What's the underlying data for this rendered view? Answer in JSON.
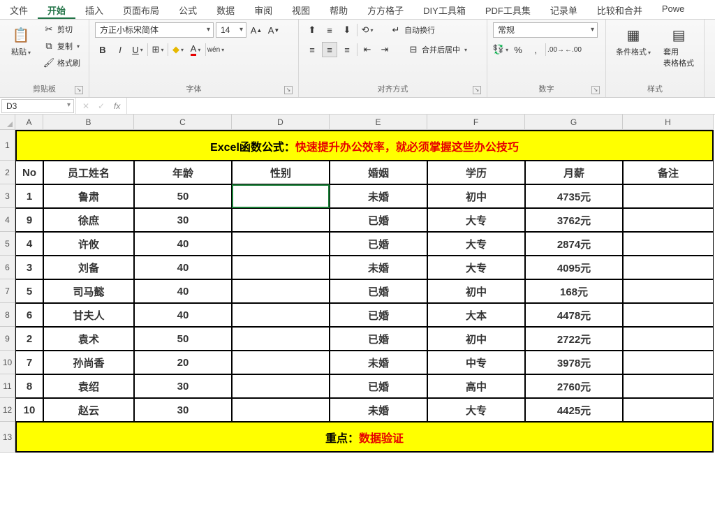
{
  "menu": {
    "file": "文件",
    "home": "开始",
    "insert": "插入",
    "layout": "页面布局",
    "formula": "公式",
    "data": "数据",
    "review": "审阅",
    "view": "视图",
    "help": "帮助",
    "ffg": "方方格子",
    "diy": "DIY工具箱",
    "pdf": "PDF工具集",
    "record": "记录单",
    "compare": "比较和合并",
    "power": "Powe"
  },
  "ribbon": {
    "clipboard": {
      "paste": "粘贴",
      "cut": "剪切",
      "copy": "复制",
      "format": "格式刷",
      "label": "剪贴板"
    },
    "font": {
      "name": "方正小标宋简体",
      "size": "14",
      "label": "字体"
    },
    "align": {
      "wrap": "自动换行",
      "merge": "合并后居中",
      "label": "对齐方式"
    },
    "number": {
      "format": "常规",
      "label": "数字"
    },
    "style": {
      "cond": "条件格式",
      "table": "套用\n表格格式",
      "label": "样式"
    }
  },
  "addr": {
    "cell": "D3",
    "formula": ""
  },
  "cols": [
    "A",
    "B",
    "C",
    "D",
    "E",
    "F",
    "G",
    "H"
  ],
  "title": {
    "p1": "Excel函数公式：",
    "p2": "快速提升办公效率，就必须掌握这些办公技巧"
  },
  "headers": [
    "No",
    "员工姓名",
    "年龄",
    "性别",
    "婚姻",
    "学历",
    "月薪",
    "备注"
  ],
  "rows": [
    {
      "no": "1",
      "name": "鲁肃",
      "age": "50",
      "gender": "",
      "marry": "未婚",
      "edu": "初中",
      "salary": "4735元",
      "note": ""
    },
    {
      "no": "9",
      "name": "徐庶",
      "age": "30",
      "gender": "",
      "marry": "已婚",
      "edu": "大专",
      "salary": "3762元",
      "note": ""
    },
    {
      "no": "4",
      "name": "许攸",
      "age": "40",
      "gender": "",
      "marry": "已婚",
      "edu": "大专",
      "salary": "2874元",
      "note": ""
    },
    {
      "no": "3",
      "name": "刘备",
      "age": "40",
      "gender": "",
      "marry": "未婚",
      "edu": "大专",
      "salary": "4095元",
      "note": ""
    },
    {
      "no": "5",
      "name": "司马懿",
      "age": "40",
      "gender": "",
      "marry": "已婚",
      "edu": "初中",
      "salary": "168元",
      "note": ""
    },
    {
      "no": "6",
      "name": "甘夫人",
      "age": "40",
      "gender": "",
      "marry": "已婚",
      "edu": "大本",
      "salary": "4478元",
      "note": ""
    },
    {
      "no": "2",
      "name": "袁术",
      "age": "50",
      "gender": "",
      "marry": "已婚",
      "edu": "初中",
      "salary": "2722元",
      "note": ""
    },
    {
      "no": "7",
      "name": "孙尚香",
      "age": "20",
      "gender": "",
      "marry": "未婚",
      "edu": "中专",
      "salary": "3978元",
      "note": ""
    },
    {
      "no": "8",
      "name": "袁绍",
      "age": "30",
      "gender": "",
      "marry": "已婚",
      "edu": "高中",
      "salary": "2760元",
      "note": ""
    },
    {
      "no": "10",
      "name": "赵云",
      "age": "30",
      "gender": "",
      "marry": "未婚",
      "edu": "大专",
      "salary": "4425元",
      "note": ""
    }
  ],
  "footer": {
    "p1": "重点：",
    "p2": "数据验证"
  },
  "rownums": [
    "1",
    "2",
    "3",
    "4",
    "5",
    "6",
    "7",
    "8",
    "9",
    "10",
    "11",
    "12",
    "13"
  ]
}
